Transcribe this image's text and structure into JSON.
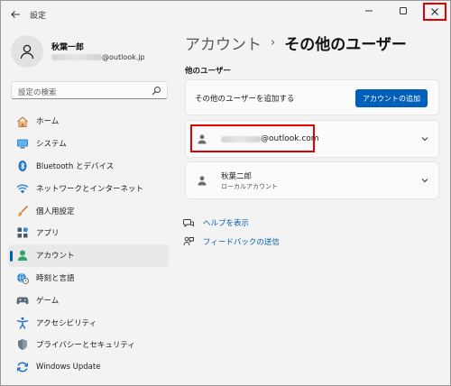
{
  "window": {
    "title": "設定",
    "back_icon": "back-arrow-icon"
  },
  "profile": {
    "name": "秋葉一郎",
    "email_suffix": "@outlook.jp"
  },
  "search": {
    "placeholder": "設定の検索"
  },
  "sidebar": {
    "items": [
      {
        "label": "ホーム",
        "icon": "home-icon",
        "active": false
      },
      {
        "label": "システム",
        "icon": "system-icon",
        "active": false
      },
      {
        "label": "Bluetooth とデバイス",
        "icon": "bluetooth-icon",
        "active": false
      },
      {
        "label": "ネットワークとインターネット",
        "icon": "wifi-icon",
        "active": false
      },
      {
        "label": "個人用設定",
        "icon": "brush-icon",
        "active": false
      },
      {
        "label": "アプリ",
        "icon": "apps-icon",
        "active": false
      },
      {
        "label": "アカウント",
        "icon": "account-icon",
        "active": true
      },
      {
        "label": "時刻と言語",
        "icon": "globe-clock-icon",
        "active": false
      },
      {
        "label": "ゲーム",
        "icon": "gamepad-icon",
        "active": false
      },
      {
        "label": "アクセシビリティ",
        "icon": "accessibility-icon",
        "active": false
      },
      {
        "label": "プライバシーとセキュリティ",
        "icon": "shield-icon",
        "active": false
      },
      {
        "label": "Windows Update",
        "icon": "update-icon",
        "active": false
      }
    ]
  },
  "main": {
    "breadcrumb": {
      "parent": "アカウント",
      "separator": "›",
      "current": "その他のユーザー"
    },
    "section_title": "他のユーザー",
    "add_user": {
      "label": "その他のユーザーを追加する",
      "button": "アカウントの追加"
    },
    "users": [
      {
        "email_suffix": "@outlook.com"
      },
      {
        "name": "秋葉二郎",
        "type": "ローカルアカウント"
      }
    ],
    "links": {
      "help": "ヘルプを表示",
      "feedback": "フィードバックの送信"
    }
  },
  "colors": {
    "accent": "#005fb8",
    "highlight": "#e00000",
    "window_bg": "#f3f3f3"
  }
}
